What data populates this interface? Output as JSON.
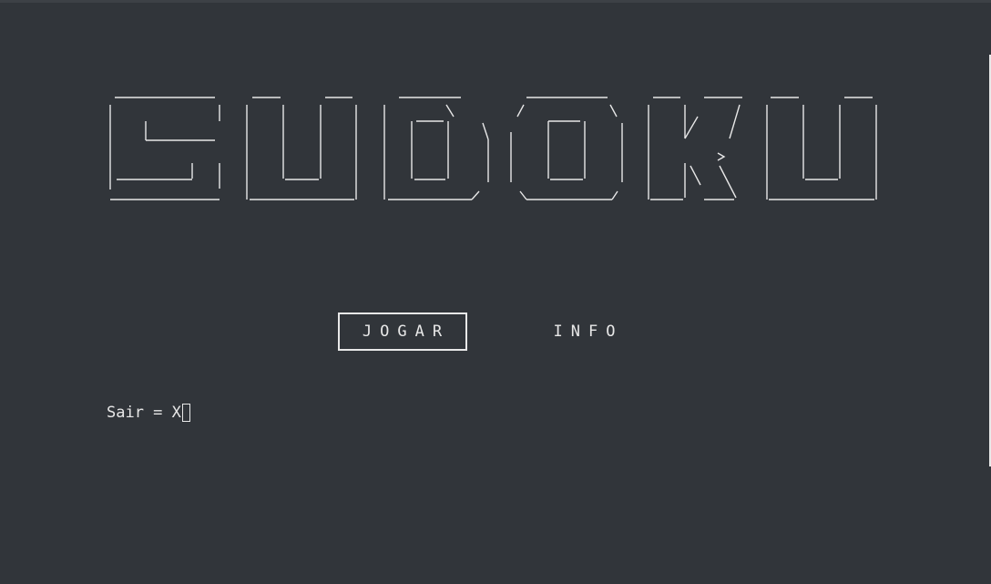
{
  "logo": {
    "text": "SUDOKU"
  },
  "menu": {
    "play_label": "JOGAR",
    "info_label": "INFO"
  },
  "footer": {
    "exit_hint": "Sair = X"
  },
  "colors": {
    "background": "#31353a",
    "foreground": "#e8e8e8"
  }
}
